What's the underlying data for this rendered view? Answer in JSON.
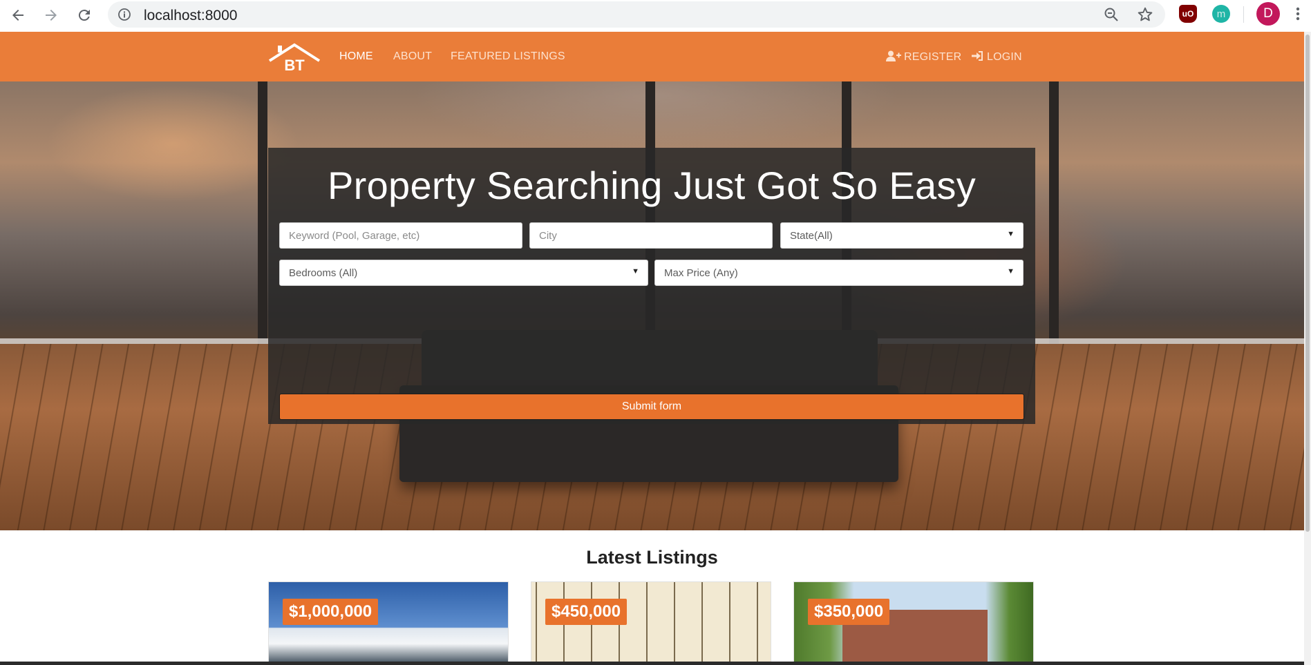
{
  "browser": {
    "url": "localhost:8000",
    "profile_initial": "D",
    "extensions": [
      {
        "name": "ublock-origin",
        "glyph": "uO"
      },
      {
        "name": "extension-m",
        "glyph": "m"
      }
    ]
  },
  "navbar": {
    "brand": "BT",
    "links": [
      {
        "label": "HOME",
        "active": true
      },
      {
        "label": "ABOUT",
        "active": false
      },
      {
        "label": "FEATURED LISTINGS",
        "active": false
      }
    ],
    "register_label": "REGISTER",
    "login_label": "LOGIN",
    "color": "#ea7d39"
  },
  "search": {
    "title": "Property Searching Just Got So Easy",
    "keyword_placeholder": "Keyword (Pool, Garage, etc)",
    "city_placeholder": "City",
    "state_selected": "State(All)",
    "bedrooms_selected": "Bedrooms (All)",
    "max_price_selected": "Max Price (Any)",
    "submit_label": "Submit form",
    "accent": "#e8722c"
  },
  "listings": {
    "title": "Latest Listings",
    "items": [
      {
        "price": "$1,000,000"
      },
      {
        "price": "$450,000"
      },
      {
        "price": "$350,000"
      }
    ]
  }
}
